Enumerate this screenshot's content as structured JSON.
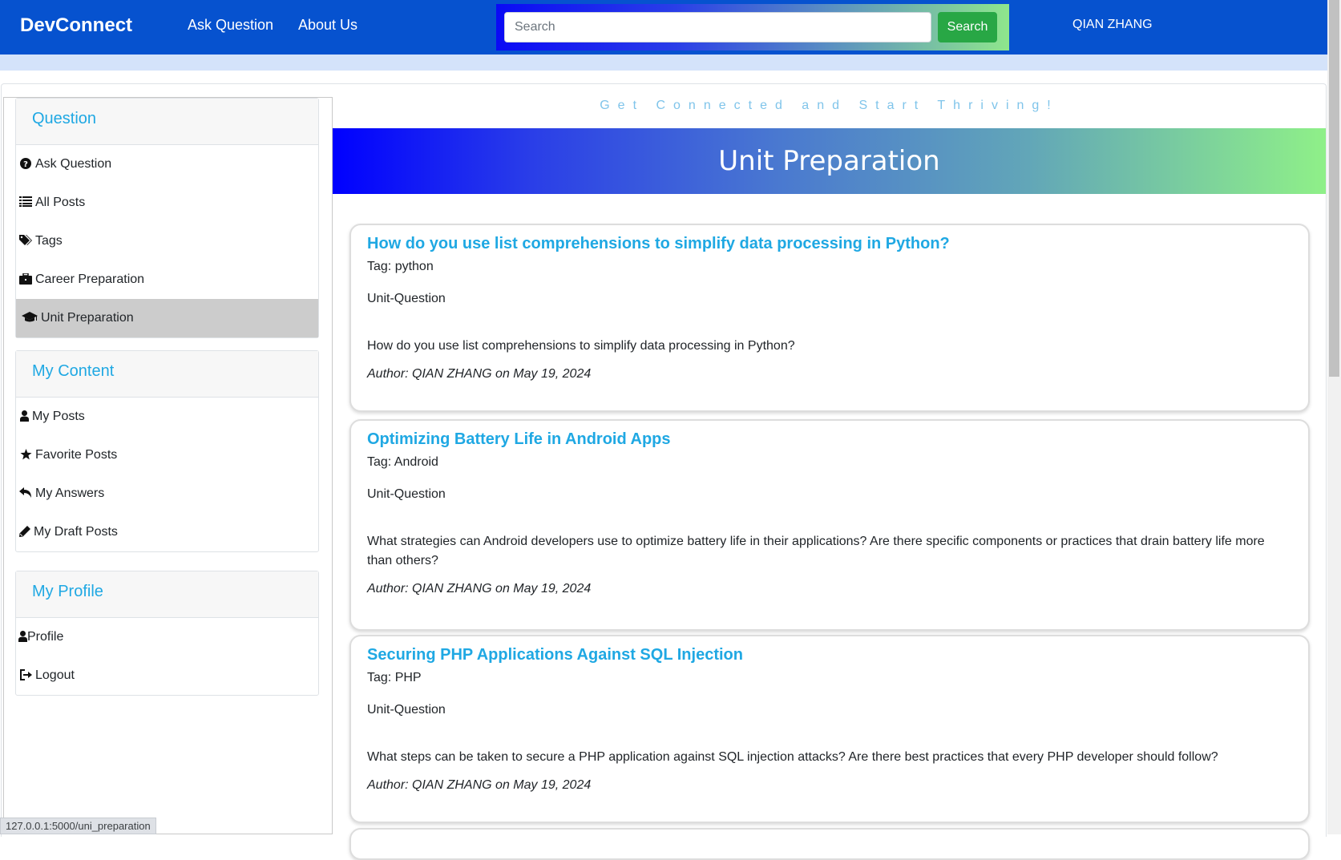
{
  "navbar": {
    "brand": "DevConnect",
    "links": [
      "Ask Question",
      "About Us"
    ],
    "search_placeholder": "Search",
    "search_button": "Search",
    "username": "QIAN ZHANG"
  },
  "sidebar": {
    "question": {
      "header": "Question",
      "items": [
        {
          "label": "Ask Question",
          "icon": "question-circle-icon"
        },
        {
          "label": "All Posts",
          "icon": "list-icon"
        },
        {
          "label": "Tags",
          "icon": "tags-icon"
        },
        {
          "label": "Career Preparation",
          "icon": "briefcase-icon"
        },
        {
          "label": "Unit Preparation",
          "icon": "graduation-cap-icon",
          "active": true
        }
      ]
    },
    "my_content": {
      "header": "My Content",
      "items": [
        {
          "label": "My Posts",
          "icon": "user-icon"
        },
        {
          "label": "Favorite Posts",
          "icon": "star-icon"
        },
        {
          "label": "My Answers",
          "icon": "reply-icon"
        },
        {
          "label": "My Draft Posts",
          "icon": "pencil-icon"
        }
      ]
    },
    "my_profile": {
      "header": "My Profile",
      "items": [
        {
          "label": "Profile",
          "icon": "user-icon"
        },
        {
          "label": "Logout",
          "icon": "sign-out-icon"
        }
      ]
    }
  },
  "main": {
    "tagline": "Get Connected and Start Thriving!",
    "banner_title": "Unit Preparation",
    "posts": [
      {
        "title": "How do you use list comprehensions to simplify data processing in Python?",
        "tag": "Tag: python",
        "type": "Unit-Question",
        "body": "How do you use list comprehensions to simplify data processing in Python?",
        "author": "Author: QIAN ZHANG on May 19, 2024"
      },
      {
        "title": "Optimizing Battery Life in Android Apps",
        "tag": "Tag: Android",
        "type": "Unit-Question",
        "body": "What strategies can Android developers use to optimize battery life in their applications? Are there specific components or practices that drain battery life more than others?",
        "author": "Author: QIAN ZHANG on May 19, 2024"
      },
      {
        "title": "Securing PHP Applications Against SQL Injection",
        "tag": "Tag: PHP",
        "type": "Unit-Question",
        "body": "What steps can be taken to secure a PHP application against SQL injection attacks? Are there best practices that every PHP developer should follow?",
        "author": "Author: QIAN ZHANG on May 19, 2024"
      }
    ]
  },
  "status_bar": {
    "url": "127.0.0.1:5000/uni_preparation"
  },
  "colors": {
    "navbar": "#0652cf",
    "accent": "#1fa8e3",
    "search_button": "#28a745",
    "active_item": "#cccccc"
  }
}
